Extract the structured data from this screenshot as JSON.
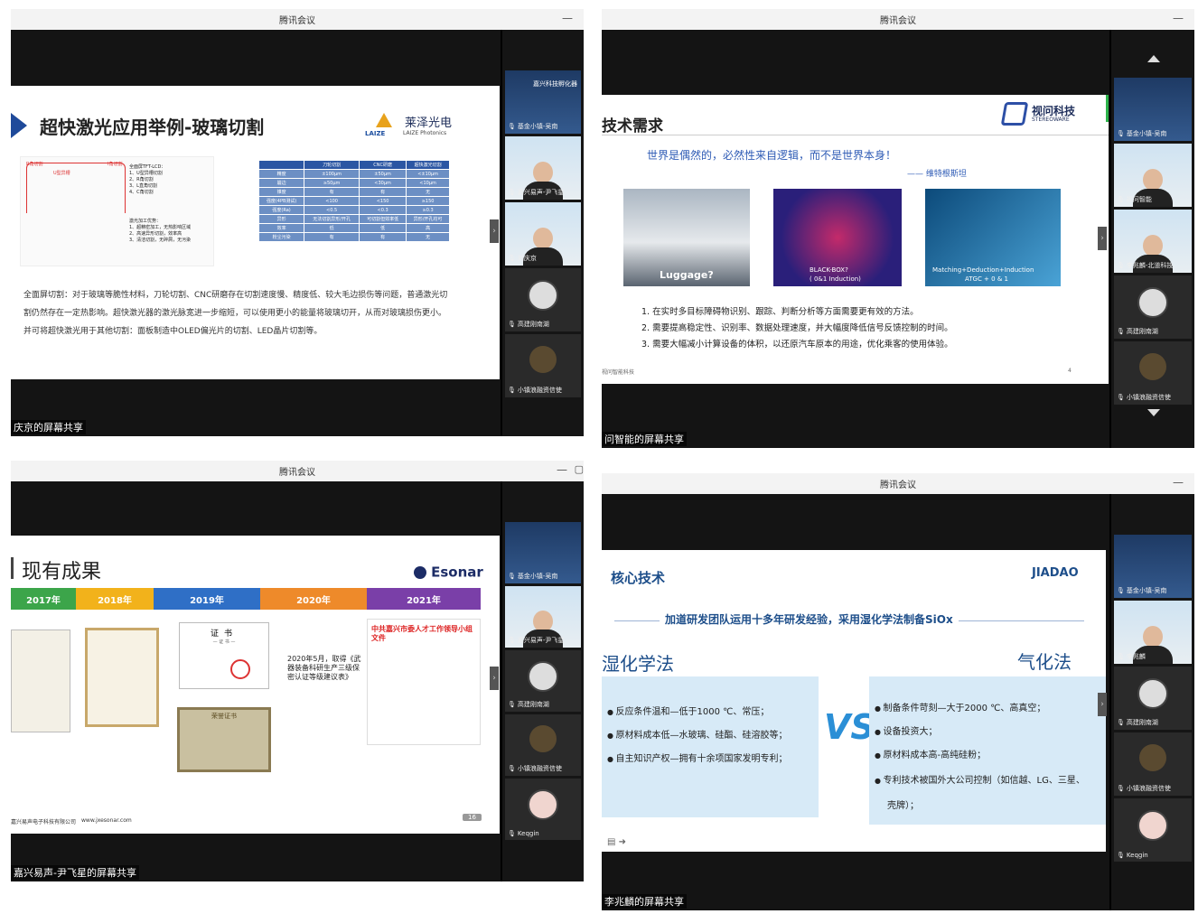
{
  "windows": [
    {
      "title": "腾讯会议",
      "minimize": "—",
      "share_label": "庆京的屏幕共享",
      "slide": {
        "title": "超快激光应用举例-玻璃切割",
        "brand_cn": "莱泽光电",
        "brand_en": "LAIZE Photonics",
        "brand_mark": "LAIZE",
        "diag_label1": "R角切割",
        "diag_label2": "U型异槽",
        "diag_label3": "I角切割",
        "diag_text1": "全面屏TFT-LCD：",
        "diag_list1": [
          "1、U型异槽切割",
          "2、R角切割",
          "3、L直角切割",
          "4、C角切割"
        ],
        "diag_text2": "激光加工优势：",
        "diag_list2": [
          "1、超精密加工，无热影响区域",
          "2、高速异形切割，效率高",
          "3、清洁切割，无碎屑，无污染"
        ],
        "table": [
          [
            "",
            "刀轮切割",
            "CNC研磨",
            "超快激光切割"
          ],
          [
            "精度",
            "±100μm",
            "±50μm",
            "<±10μm"
          ],
          [
            "崩边",
            "≥50μm",
            "<30μm",
            "<10μm"
          ],
          [
            "锥度",
            "有",
            "有",
            "无"
          ],
          [
            "强度(4PB测试)",
            "<100",
            "<150",
            "≥150"
          ],
          [
            "强度(Ra)",
            "<0.5",
            "<0.3",
            "≥0.3"
          ],
          [
            "异形",
            "无法切割异形/开孔",
            "可切割但效率低",
            "异形/开孔均可"
          ],
          [
            "效率",
            "低",
            "低",
            "高"
          ],
          [
            "粉尘污染",
            "有",
            "有",
            "无"
          ]
        ],
        "body": "全面屏切割：对于玻璃等脆性材料，刀轮切割、CNC研磨存在切割速度慢、精度低、较大毛边损伤等问题，普通激光切割仍然存在一定热影响。超快激光器的激光脉宽进一步缩短，可以使用更小的能量将玻璃切开，从而对玻璃损伤更小。并可将超快激光用于其他切割：面板制造中OLED偏光片的切割、LED晶片切割等。",
        "body_lead": "全面屏切割："
      },
      "participants": [
        {
          "name": "基金小镇-吴南",
          "type": "logo",
          "org": "嘉兴科技孵化器"
        },
        {
          "name": "嘉兴易声-尹飞星",
          "type": "cam"
        },
        {
          "name": "刘庆京",
          "type": "cam"
        },
        {
          "name": "高建刚南湖",
          "type": "av"
        },
        {
          "name": "小镇浪融资信使",
          "type": "plant"
        }
      ]
    },
    {
      "title": "腾讯会议",
      "minimize": "—",
      "share_label": "问智能的屏幕共享",
      "slide": {
        "title": "技术需求",
        "brand_cn": "视问科技",
        "brand_en": "STEREOWARE",
        "quote": "世界是偶然的，必然性来自逻辑，而不是世界本身！",
        "author": "—— 维特根斯坦",
        "img1": "Luggage?",
        "img2": "BLACK-BOX?",
        "img2b": "( 0&1 Induction)",
        "img3": "Matching+Deduction+Induction",
        "img3b": "ATGC + 0 & 1",
        "items": [
          "1. 在实时多目标障碍物识别、跟踪、判断分析等方面需要更有效的方法。",
          "2. 需要提高稳定性、识别率、数据处理速度，并大幅度降低信号反馈控制的时间。",
          "3. 需要大幅减小计算设备的体积，以还原汽车原本的用途，优化乘客的使用体验。"
        ],
        "footer": "视问智能科技",
        "page": "4"
      },
      "participants": [
        {
          "name": "基金小镇-吴南",
          "type": "logo"
        },
        {
          "name": "视问智能",
          "type": "cam"
        },
        {
          "name": "李兆麟-北道科技",
          "type": "cam"
        },
        {
          "name": "高建刚南湖",
          "type": "av"
        },
        {
          "name": "小镇浪融资信使",
          "type": "plant"
        }
      ]
    },
    {
      "title": "腾讯会议",
      "minimize": "—",
      "share_label": "嘉兴易声-尹飞星的屏幕共享",
      "slide": {
        "title": "现有成果",
        "brand": "Esonar",
        "years": [
          {
            "label": "2017年",
            "color": "#3ca54a"
          },
          {
            "label": "2018年",
            "color": "#f2b21b"
          },
          {
            "label": "2019年",
            "color": "#2f6fc6"
          },
          {
            "label": "2020年",
            "color": "#ee8a2a"
          },
          {
            "label": "2021年",
            "color": "#7a3fa8"
          }
        ],
        "cert_title": "证书",
        "cert_sub": "— 证 书 —",
        "cert_plaque": "荣誉证书",
        "note": "2020年5月，取得《武器装备科研生产三级保密认证等级建议表》",
        "doc_title": "中共嘉兴市委人才工作领导小组文件",
        "footer_company": "嘉兴易声电子科技有限公司",
        "footer_url": "www.jxesonar.com",
        "page": "16"
      },
      "participants": [
        {
          "name": "基金小镇-吴南",
          "type": "logo"
        },
        {
          "name": "嘉兴易声-尹飞星",
          "type": "cam"
        },
        {
          "name": "高建刚南湖",
          "type": "av"
        },
        {
          "name": "小镇浪融资信使",
          "type": "plant"
        },
        {
          "name": "Keqgin",
          "type": "av"
        }
      ]
    },
    {
      "title": "腾讯会议",
      "minimize": "—",
      "share_label": "李兆麟的屏幕共享",
      "slide": {
        "title": "核心技术",
        "brand": "JIADAO",
        "banner": "加道研发团队运用十多年研发经验，采用湿化学法制备SiOx",
        "left_title": "湿化学法",
        "right_title": "气化法",
        "vs": "VS",
        "left_items": [
          "反应条件温和—低于1000 ℃、常压；",
          "原材料成本低—水玻璃、硅酯、硅溶胶等；",
          "自主知识产权—拥有十余项国家发明专利；"
        ],
        "right_items": [
          "制备条件苛刻—大于2000 ℃、高真空；",
          "设备投资大；",
          "原材料成本高-高纯硅粉；",
          "专利技术被国外大公司控制（如信越、LG、三星、",
          "壳牌）；"
        ]
      },
      "participants": [
        {
          "name": "基金小镇-吴南",
          "type": "logo"
        },
        {
          "name": "李兆麟",
          "type": "cam"
        },
        {
          "name": "高建刚南湖",
          "type": "av"
        },
        {
          "name": "小镇浪融资信使",
          "type": "plant"
        },
        {
          "name": "Keqgin",
          "type": "av"
        }
      ]
    }
  ]
}
